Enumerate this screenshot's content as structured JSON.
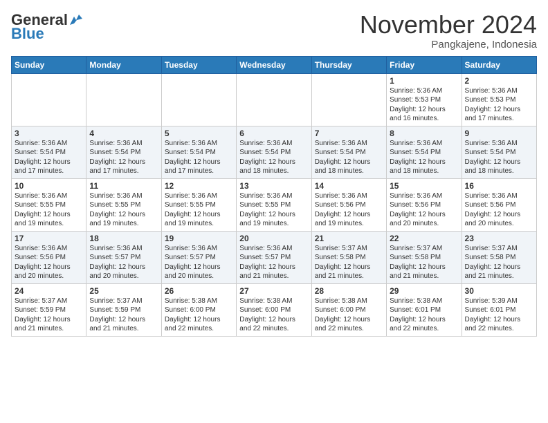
{
  "header": {
    "logo_general": "General",
    "logo_blue": "Blue",
    "month": "November 2024",
    "location": "Pangkajene, Indonesia"
  },
  "weekdays": [
    "Sunday",
    "Monday",
    "Tuesday",
    "Wednesday",
    "Thursday",
    "Friday",
    "Saturday"
  ],
  "weeks": [
    [
      {
        "day": "",
        "info": ""
      },
      {
        "day": "",
        "info": ""
      },
      {
        "day": "",
        "info": ""
      },
      {
        "day": "",
        "info": ""
      },
      {
        "day": "",
        "info": ""
      },
      {
        "day": "1",
        "info": "Sunrise: 5:36 AM\nSunset: 5:53 PM\nDaylight: 12 hours\nand 16 minutes."
      },
      {
        "day": "2",
        "info": "Sunrise: 5:36 AM\nSunset: 5:53 PM\nDaylight: 12 hours\nand 17 minutes."
      }
    ],
    [
      {
        "day": "3",
        "info": "Sunrise: 5:36 AM\nSunset: 5:54 PM\nDaylight: 12 hours\nand 17 minutes."
      },
      {
        "day": "4",
        "info": "Sunrise: 5:36 AM\nSunset: 5:54 PM\nDaylight: 12 hours\nand 17 minutes."
      },
      {
        "day": "5",
        "info": "Sunrise: 5:36 AM\nSunset: 5:54 PM\nDaylight: 12 hours\nand 17 minutes."
      },
      {
        "day": "6",
        "info": "Sunrise: 5:36 AM\nSunset: 5:54 PM\nDaylight: 12 hours\nand 18 minutes."
      },
      {
        "day": "7",
        "info": "Sunrise: 5:36 AM\nSunset: 5:54 PM\nDaylight: 12 hours\nand 18 minutes."
      },
      {
        "day": "8",
        "info": "Sunrise: 5:36 AM\nSunset: 5:54 PM\nDaylight: 12 hours\nand 18 minutes."
      },
      {
        "day": "9",
        "info": "Sunrise: 5:36 AM\nSunset: 5:54 PM\nDaylight: 12 hours\nand 18 minutes."
      }
    ],
    [
      {
        "day": "10",
        "info": "Sunrise: 5:36 AM\nSunset: 5:55 PM\nDaylight: 12 hours\nand 19 minutes."
      },
      {
        "day": "11",
        "info": "Sunrise: 5:36 AM\nSunset: 5:55 PM\nDaylight: 12 hours\nand 19 minutes."
      },
      {
        "day": "12",
        "info": "Sunrise: 5:36 AM\nSunset: 5:55 PM\nDaylight: 12 hours\nand 19 minutes."
      },
      {
        "day": "13",
        "info": "Sunrise: 5:36 AM\nSunset: 5:55 PM\nDaylight: 12 hours\nand 19 minutes."
      },
      {
        "day": "14",
        "info": "Sunrise: 5:36 AM\nSunset: 5:56 PM\nDaylight: 12 hours\nand 19 minutes."
      },
      {
        "day": "15",
        "info": "Sunrise: 5:36 AM\nSunset: 5:56 PM\nDaylight: 12 hours\nand 20 minutes."
      },
      {
        "day": "16",
        "info": "Sunrise: 5:36 AM\nSunset: 5:56 PM\nDaylight: 12 hours\nand 20 minutes."
      }
    ],
    [
      {
        "day": "17",
        "info": "Sunrise: 5:36 AM\nSunset: 5:56 PM\nDaylight: 12 hours\nand 20 minutes."
      },
      {
        "day": "18",
        "info": "Sunrise: 5:36 AM\nSunset: 5:57 PM\nDaylight: 12 hours\nand 20 minutes."
      },
      {
        "day": "19",
        "info": "Sunrise: 5:36 AM\nSunset: 5:57 PM\nDaylight: 12 hours\nand 20 minutes."
      },
      {
        "day": "20",
        "info": "Sunrise: 5:36 AM\nSunset: 5:57 PM\nDaylight: 12 hours\nand 21 minutes."
      },
      {
        "day": "21",
        "info": "Sunrise: 5:37 AM\nSunset: 5:58 PM\nDaylight: 12 hours\nand 21 minutes."
      },
      {
        "day": "22",
        "info": "Sunrise: 5:37 AM\nSunset: 5:58 PM\nDaylight: 12 hours\nand 21 minutes."
      },
      {
        "day": "23",
        "info": "Sunrise: 5:37 AM\nSunset: 5:58 PM\nDaylight: 12 hours\nand 21 minutes."
      }
    ],
    [
      {
        "day": "24",
        "info": "Sunrise: 5:37 AM\nSunset: 5:59 PM\nDaylight: 12 hours\nand 21 minutes."
      },
      {
        "day": "25",
        "info": "Sunrise: 5:37 AM\nSunset: 5:59 PM\nDaylight: 12 hours\nand 21 minutes."
      },
      {
        "day": "26",
        "info": "Sunrise: 5:38 AM\nSunset: 6:00 PM\nDaylight: 12 hours\nand 22 minutes."
      },
      {
        "day": "27",
        "info": "Sunrise: 5:38 AM\nSunset: 6:00 PM\nDaylight: 12 hours\nand 22 minutes."
      },
      {
        "day": "28",
        "info": "Sunrise: 5:38 AM\nSunset: 6:00 PM\nDaylight: 12 hours\nand 22 minutes."
      },
      {
        "day": "29",
        "info": "Sunrise: 5:38 AM\nSunset: 6:01 PM\nDaylight: 12 hours\nand 22 minutes."
      },
      {
        "day": "30",
        "info": "Sunrise: 5:39 AM\nSunset: 6:01 PM\nDaylight: 12 hours\nand 22 minutes."
      }
    ]
  ]
}
